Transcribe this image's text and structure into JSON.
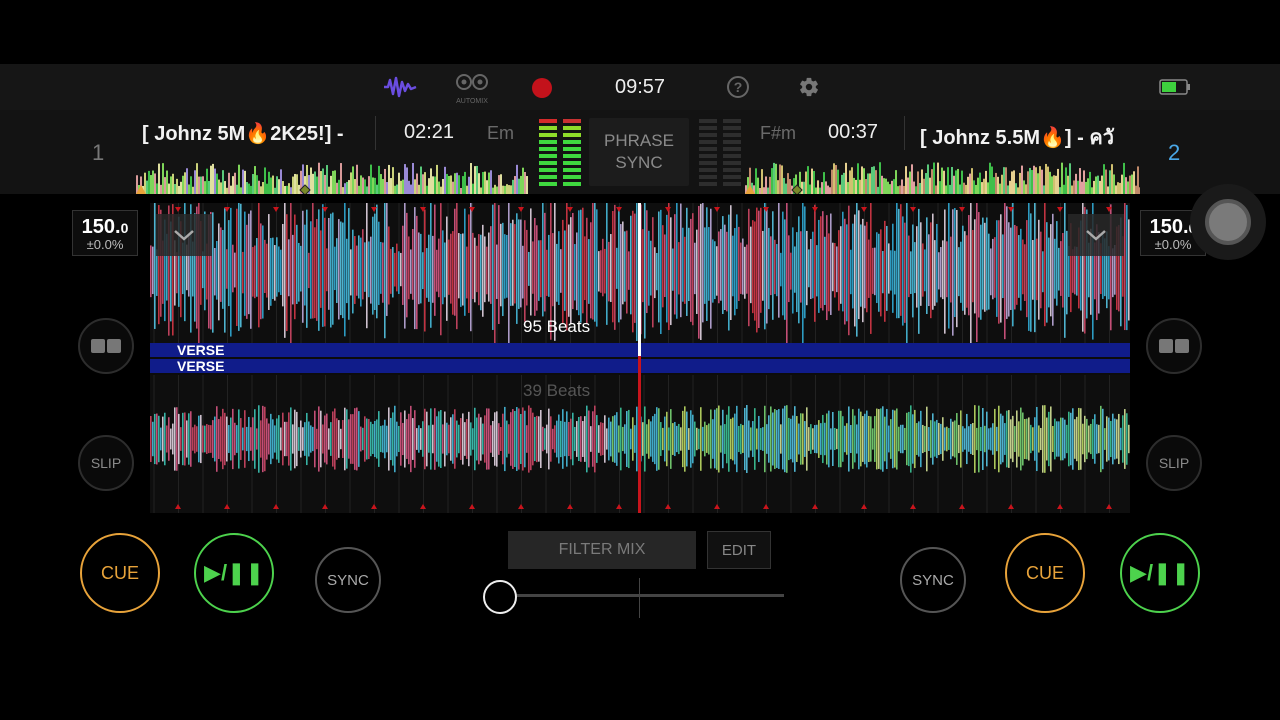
{
  "topbar": {
    "waveform_icon": "waveform-icon",
    "automix_label": "AUTOMIX",
    "clock": "09:57",
    "record_color": "#c3121b",
    "accent": "#6a4de0"
  },
  "deck1": {
    "number": "1",
    "title": "[ Johnz 5M🔥2K25!] -",
    "time": "02:21",
    "key": "Em",
    "bpm_int": "150.",
    "bpm_dec": "0",
    "pitch": "±0.0%",
    "beats": "95 Beats",
    "slip": "SLIP",
    "cue": "CUE",
    "play": "▶/❚❚",
    "sync": "SYNC"
  },
  "deck2": {
    "number": "2",
    "title": "[ Johnz 5.5M🔥] - ควั",
    "time": "00:37",
    "key": "F#m",
    "bpm_int": "150.",
    "bpm_dec": "0",
    "pitch": "±0.0%",
    "beats": "39 Beats",
    "slip": "SLIP",
    "cue": "CUE",
    "play": "▶/❚❚",
    "sync": "SYNC",
    "number_color": "#4aa8e8"
  },
  "phrase_sync": {
    "line1": "PHRASE",
    "line2": "SYNC"
  },
  "phrase_labels": {
    "top": "VERSE",
    "bottom": "VERSE"
  },
  "mixer": {
    "filter_mix": "FILTER MIX",
    "edit": "EDIT",
    "crossfader_position": 0.0
  },
  "colors": {
    "cue": "#e8a33a",
    "play": "#4dd24d",
    "verse_band": "#101c8a"
  }
}
